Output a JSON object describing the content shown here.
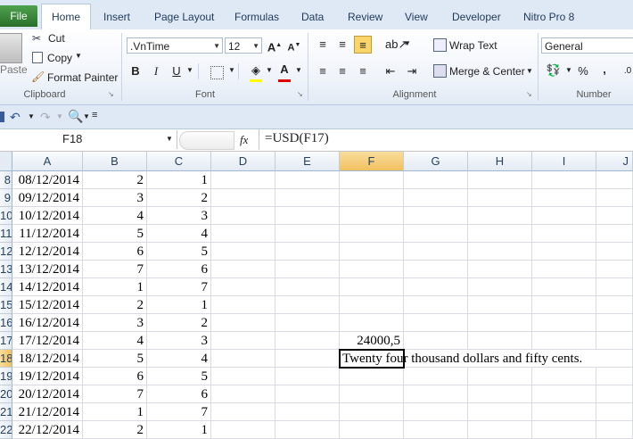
{
  "tabs": {
    "file": "File",
    "home": "Home",
    "others": [
      "Insert",
      "Page Layout",
      "Formulas",
      "Data",
      "Review",
      "View",
      "Developer",
      "Nitro Pro 8"
    ]
  },
  "ribbon": {
    "clipboard": {
      "paste": "Paste",
      "cut": "Cut",
      "copy": "Copy",
      "format_painter": "Format Painter",
      "label": "Clipboard"
    },
    "font": {
      "name": ".VnTime",
      "size": "12",
      "bold": "B",
      "italic": "I",
      "underline": "U",
      "label": "Font"
    },
    "alignment": {
      "wrap_text": "Wrap Text",
      "merge_center": "Merge & Center",
      "label": "Alignment"
    },
    "number": {
      "format": "General",
      "percent": "%",
      "comma": ",",
      "label": "Number"
    }
  },
  "formula_bar": {
    "name_box": "F18",
    "fx": "fx",
    "formula": "=USD(F17)"
  },
  "columns": [
    "A",
    "B",
    "C",
    "D",
    "E",
    "F",
    "G",
    "H",
    "I",
    "J"
  ],
  "rows": [
    {
      "n": "8",
      "a": "08/12/2014",
      "b": "2",
      "c": "1"
    },
    {
      "n": "9",
      "a": "09/12/2014",
      "b": "3",
      "c": "2"
    },
    {
      "n": "10",
      "a": "10/12/2014",
      "b": "4",
      "c": "3"
    },
    {
      "n": "11",
      "a": "11/12/2014",
      "b": "5",
      "c": "4"
    },
    {
      "n": "12",
      "a": "12/12/2014",
      "b": "6",
      "c": "5"
    },
    {
      "n": "13",
      "a": "13/12/2014",
      "b": "7",
      "c": "6"
    },
    {
      "n": "14",
      "a": "14/12/2014",
      "b": "1",
      "c": "7"
    },
    {
      "n": "15",
      "a": "15/12/2014",
      "b": "2",
      "c": "1"
    },
    {
      "n": "16",
      "a": "16/12/2014",
      "b": "3",
      "c": "2"
    },
    {
      "n": "17",
      "a": "17/12/2014",
      "b": "4",
      "c": "3",
      "f": "24000,5"
    },
    {
      "n": "18",
      "a": "18/12/2014",
      "b": "5",
      "c": "4",
      "f": "Twenty four thousand dollars and fifty cents."
    },
    {
      "n": "19",
      "a": "19/12/2014",
      "b": "6",
      "c": "5"
    },
    {
      "n": "20",
      "a": "20/12/2014",
      "b": "7",
      "c": "6"
    },
    {
      "n": "21",
      "a": "21/12/2014",
      "b": "1",
      "c": "7"
    },
    {
      "n": "22",
      "a": "22/12/2014",
      "b": "2",
      "c": "1"
    }
  ]
}
